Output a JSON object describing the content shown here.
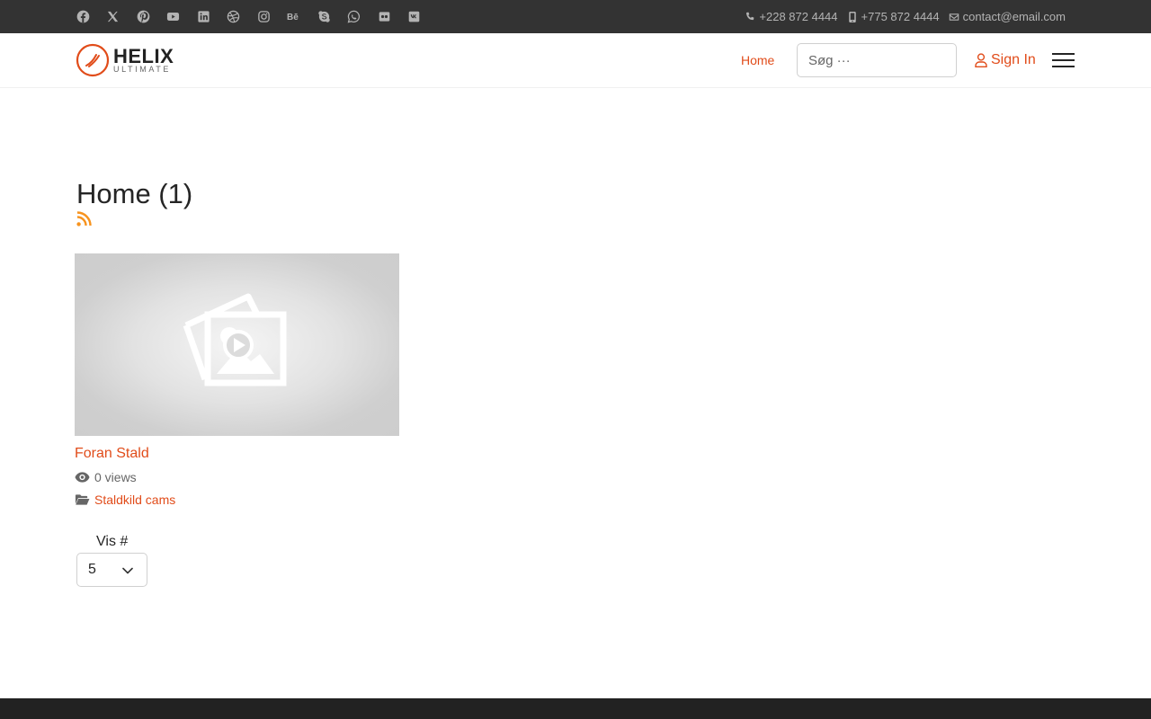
{
  "topbar": {
    "social_icons": [
      "facebook-icon",
      "x-twitter-icon",
      "pinterest-icon",
      "youtube-icon",
      "linkedin-icon",
      "dribbble-icon",
      "instagram-icon",
      "behance-icon",
      "skype-icon",
      "whatsapp-icon",
      "flickr-icon",
      "vk-icon"
    ],
    "phone": "+228 872 4444",
    "mobile": "+775 872 4444",
    "email": "contact@email.com"
  },
  "header": {
    "logo_main": "HELIX",
    "logo_sub": "ULTIMATE",
    "nav_home": "Home",
    "search_placeholder": "Søg ···",
    "sign_in": "Sign In"
  },
  "main": {
    "title": "Home (1)",
    "video": {
      "title": "Foran Stald",
      "views": "0 views",
      "category": "Staldkild cams"
    },
    "limit": {
      "label": "Vis #",
      "selected": "5"
    }
  },
  "colors": {
    "accent": "#e14c1a",
    "topbar_bg": "#333333",
    "footer_bg": "#222222",
    "rss": "#f7931e"
  }
}
